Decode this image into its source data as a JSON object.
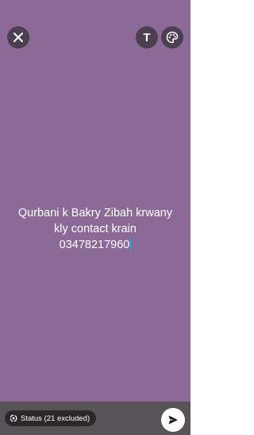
{
  "screen": {
    "background_color": "#8c6a97"
  },
  "toolbar": {
    "close_icon": "close-icon",
    "text_icon_glyph": "T",
    "palette_icon": "palette-icon"
  },
  "status": {
    "lines": [
      "Qurbani k Bakry Zibah krwany",
      "kly contact krain",
      "03478217960"
    ],
    "text_color": "#ffffff"
  },
  "bottom_bar": {
    "audience_label": "Status (21 excluded)",
    "audience_icon": "status-ring-icon",
    "send_icon": "send-icon"
  }
}
